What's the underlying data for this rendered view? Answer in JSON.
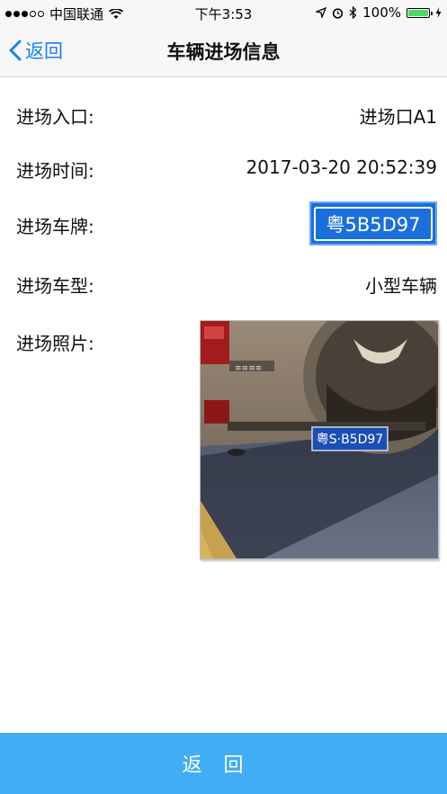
{
  "status_bar": {
    "carrier": "中国联通",
    "time": "下午3:53",
    "battery_pct": "100%",
    "battery_level": 1.0
  },
  "nav": {
    "back_label": "返回",
    "title": "车辆进场信息"
  },
  "fields": [
    {
      "label": "进场入口:",
      "value": "进场口A1"
    },
    {
      "label": "进场时间:",
      "value": "2017-03-20 20:52:39"
    },
    {
      "label": "进场车牌:",
      "value": "粤5B5D97"
    },
    {
      "label": "进场车型:",
      "value": "小型车辆"
    },
    {
      "label": "进场照片:"
    }
  ],
  "photo": {
    "plate_text": "粤S·B5D97"
  },
  "bottom_button": {
    "label": "返回"
  },
  "colors": {
    "accent": "#1a82f0",
    "plate_bg": "#1a6fdc",
    "bottom_bar": "#42adf5"
  }
}
